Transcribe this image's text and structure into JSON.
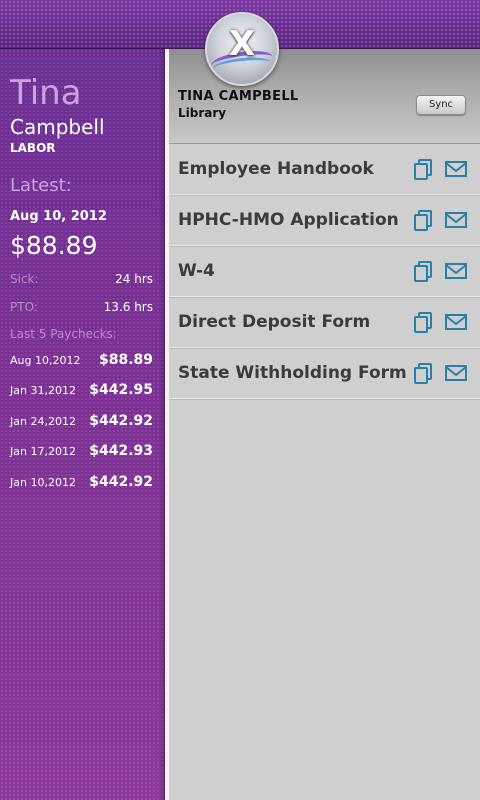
{
  "header": {
    "logo_letter": "X"
  },
  "profile": {
    "first_name": "Tina",
    "last_name": "Campbell",
    "role": "LABOR",
    "latest_label": "Latest:",
    "latest_date": "Aug 10, 2012",
    "latest_amount": "$88.89",
    "sick_label": "Sick:",
    "sick_value": "24 hrs",
    "pto_label": "PTO:",
    "pto_value": "13.6 hrs",
    "paychecks_label": "Last 5 Paychecks:",
    "paychecks": [
      {
        "date": "Aug 10,2012",
        "amount": "$88.89"
      },
      {
        "date": "Jan 31,2012",
        "amount": "$442.95"
      },
      {
        "date": "Jan 24,2012",
        "amount": "$442.92"
      },
      {
        "date": "Jan 17,2012",
        "amount": "$442.93"
      },
      {
        "date": "Jan 10,2012",
        "amount": "$442.92"
      }
    ]
  },
  "library": {
    "user": "TINA CAMPBELL",
    "title": "Library",
    "sync_label": "Sync",
    "documents": [
      {
        "title": "Employee Handbook"
      },
      {
        "title": "HPHC-HMO Application"
      },
      {
        "title": "W-4"
      },
      {
        "title": "Direct Deposit Form"
      },
      {
        "title": "State Withholding Form"
      }
    ]
  },
  "colors": {
    "brand_purple": "#6b2f94",
    "accent_teal": "#2a7fa6"
  },
  "icons": [
    "copy-document-icon",
    "email-envelope-icon",
    "x-logo-icon"
  ]
}
